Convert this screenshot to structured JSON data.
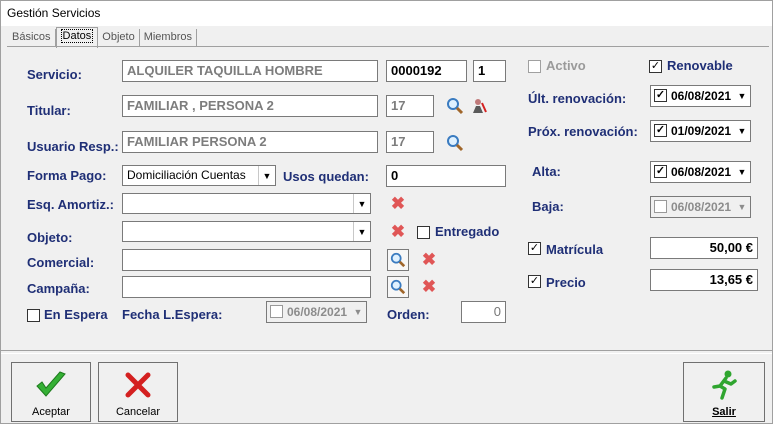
{
  "window": {
    "title": "Gestión Servicios"
  },
  "tabs": [
    {
      "label": "Básicos"
    },
    {
      "label": "Datos"
    },
    {
      "label": "Objeto"
    },
    {
      "label": "Miembros"
    }
  ],
  "form": {
    "servicio": {
      "label": "Servicio:",
      "value": "ALQUILER TAQUILLA HOMBRE",
      "code": "0000192",
      "num": "1"
    },
    "titular": {
      "label": "Titular:",
      "value": "FAMILIAR , PERSONA 2",
      "code": "17"
    },
    "usuario": {
      "label": "Usuario Resp.:",
      "value": "FAMILIAR  PERSONA 2",
      "code": "17"
    },
    "forma_pago": {
      "label": "Forma Pago:",
      "value": "Domiciliación Cuentas"
    },
    "usos": {
      "label": "Usos quedan:",
      "value": "0"
    },
    "esq": {
      "label": "Esq. Amortiz.:",
      "value": ""
    },
    "objeto": {
      "label": "Objeto:",
      "value": ""
    },
    "entregado": {
      "label": "Entregado",
      "checked": ""
    },
    "comercial": {
      "label": "Comercial:",
      "value": ""
    },
    "campana": {
      "label": "Campaña:",
      "value": ""
    },
    "en_espera": {
      "label": "En Espera",
      "checked": ""
    },
    "fecha_espera": {
      "label": "Fecha L.Espera:",
      "value": "06/08/2021"
    },
    "orden": {
      "label": "Orden:",
      "value": "0"
    }
  },
  "right": {
    "activo": {
      "label": "Activo",
      "checked": ""
    },
    "renovable": {
      "label": "Renovable",
      "checked": "✓"
    },
    "ult_renov": {
      "label": "Últ. renovación:",
      "value": "06/08/2021",
      "checked": "✓"
    },
    "prox_renov": {
      "label": "Próx. renovación:",
      "value": "01/09/2021",
      "checked": "✓"
    },
    "alta": {
      "label": "Alta:",
      "value": "06/08/2021",
      "checked": "✓"
    },
    "baja": {
      "label": "Baja:",
      "value": "06/08/2021",
      "checked": ""
    },
    "matricula": {
      "label": "Matrícula",
      "value": "50,00 €",
      "checked": "✓"
    },
    "precio": {
      "label": "Precio",
      "value": "13,65 €",
      "checked": "✓"
    }
  },
  "buttons": {
    "aceptar": "Aceptar",
    "cancelar": "Cancelar",
    "salir": "Salir"
  },
  "icons": {
    "search": "search-icon",
    "delete": "delete-icon",
    "accept": "checkmark-icon",
    "cancel": "cross-icon",
    "exit": "running-man-icon"
  },
  "colors": {
    "label": "#1f2f76",
    "accent_green": "#2fa52f",
    "accent_red": "#d42020"
  }
}
